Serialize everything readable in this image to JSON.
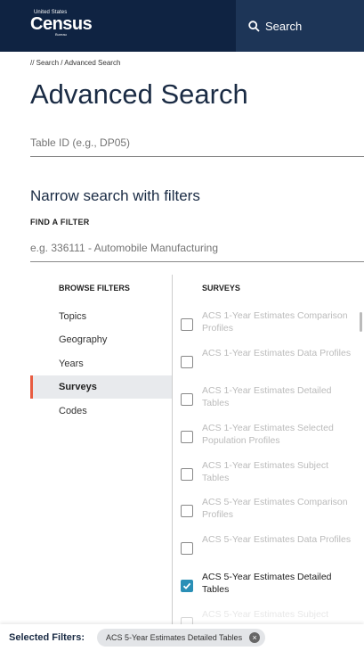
{
  "header": {
    "logo_small": "United States",
    "logo_main": "Census",
    "logo_bureau": "Bureau",
    "search_label": "Search"
  },
  "breadcrumb": "// Search / Advanced Search",
  "title": "Advanced Search",
  "table_id_placeholder": "Table ID (e.g., DP05)",
  "narrow_heading": "Narrow search with filters",
  "find_filter_label": "FIND A FILTER",
  "filter_placeholder": "e.g. 336111 - Automobile Manufacturing",
  "browse": {
    "heading": "BROWSE FILTERS",
    "items": [
      "Topics",
      "Geography",
      "Years",
      "Surveys",
      "Codes"
    ],
    "active": "Surveys"
  },
  "surveys": {
    "heading": "SURVEYS",
    "items": [
      {
        "label": "ACS 1-Year Estimates Comparison Profiles",
        "checked": false
      },
      {
        "label": "ACS 1-Year Estimates Data Profiles",
        "checked": false
      },
      {
        "label": "ACS 1-Year Estimates Detailed Tables",
        "checked": false
      },
      {
        "label": "ACS 1-Year Estimates Selected Population Profiles",
        "checked": false
      },
      {
        "label": "ACS 1-Year Estimates Subject Tables",
        "checked": false
      },
      {
        "label": "ACS 5-Year Estimates Comparison Profiles",
        "checked": false
      },
      {
        "label": "ACS 5-Year Estimates Data Profiles",
        "checked": false
      },
      {
        "label": "ACS 5-Year Estimates Detailed Tables",
        "checked": true
      },
      {
        "label": "ACS 5-Year Estimates Subject",
        "checked": false
      }
    ]
  },
  "selected_filters": {
    "label": "Selected Filters:",
    "chips": [
      "ACS 5-Year Estimates Detailed Tables"
    ]
  },
  "colors": {
    "header_bg": "#0f2342",
    "accent": "#e85c41",
    "checkbox_checked": "#2a8fb6"
  }
}
